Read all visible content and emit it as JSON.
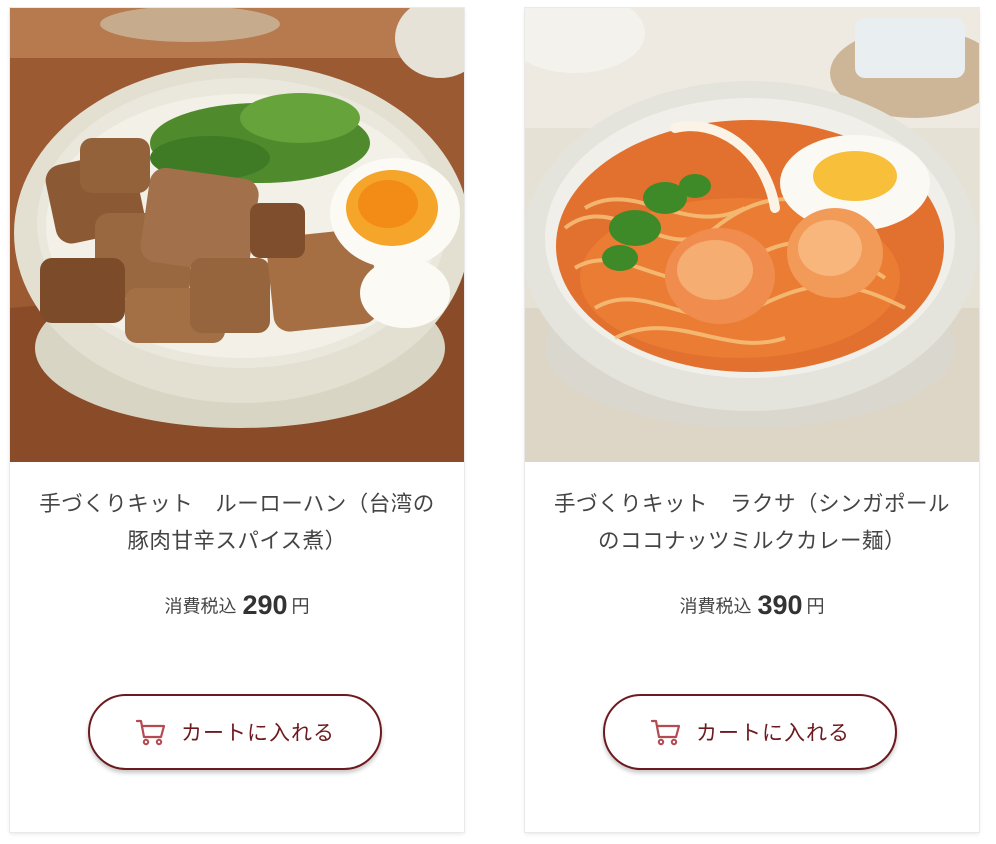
{
  "products": [
    {
      "name": "手づくりキット　ルーローハン（台湾の豚肉甘辛スパイス煮）",
      "tax_label": "消費税込",
      "price": "290",
      "currency": "円",
      "cart_label": "カートに入れる"
    },
    {
      "name": "手づくりキット　ラクサ（シンガポールのココナッツミルクカレー麺）",
      "tax_label": "消費税込",
      "price": "390",
      "currency": "円",
      "cart_label": "カートに入れる"
    }
  ],
  "colors": {
    "accent": "#6d1a1f",
    "cart_icon": "#b44a52"
  },
  "icons": {
    "cart": "cart-icon"
  }
}
